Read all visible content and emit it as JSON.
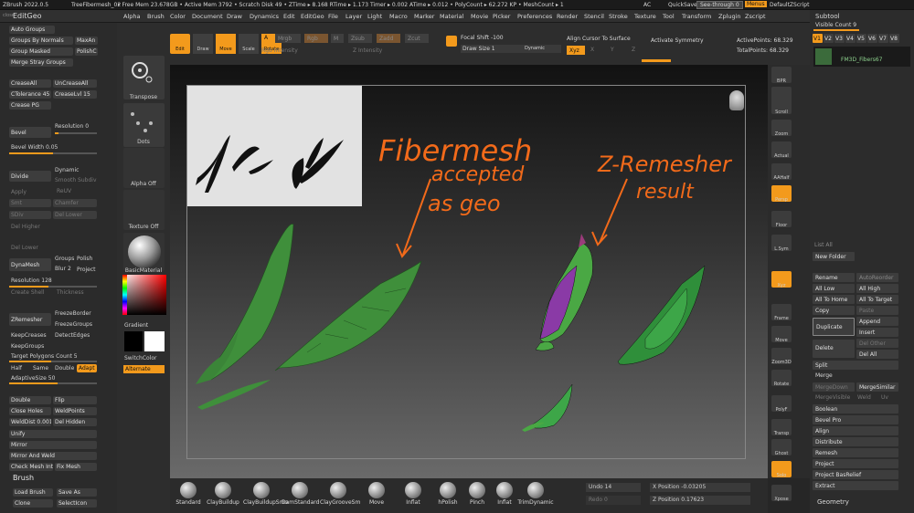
{
  "topbar": {
    "app": "ZBrush 2022.0.5",
    "file": "TreeFibermesh_02",
    "stats": "• Free Mem 23.678GB • Active Mem 3792 • Scratch Disk 49 • ZTime ▸ 8.168 RTime ▸ 1.173 Timer ▸ 0.002 ATime ▸ 0.012 • PolyCount ▸ 62.272 KP • MeshCount ▸ 1",
    "ac": "AC",
    "quicksave": "QuickSave",
    "seethrough": "See-through  0",
    "menus": "Menus",
    "script": "DefaultZScript"
  },
  "menus": [
    "Alpha",
    "Brush",
    "Color",
    "Document",
    "Draw",
    "Dynamics",
    "Edit",
    "EditGeo",
    "File",
    "Layer",
    "Light",
    "Macro",
    "Marker",
    "Material",
    "Movie",
    "Picker",
    "Preferences",
    "Render",
    "Stencil",
    "Stroke",
    "Texture",
    "Tool",
    "Transform",
    "Zplugin",
    "Zscript"
  ],
  "left": {
    "panel": "EditGeo",
    "close": "close",
    "auto_groups": "Auto Groups",
    "groups_by_normals": "Groups By Normals",
    "max_an": "MaxAn",
    "group_masked": "Group Masked",
    "polish": "PolishC",
    "merge_stray": "Merge Stray Groups",
    "crease_all": "CreaseAll",
    "uncrease_all": "UnCreaseAll",
    "ctolerance": "CTolerance 45",
    "crease_lvl": "CreaseLvl 15",
    "crease_pg": "Crease PG",
    "bevel": "Bevel",
    "resolution": "Resolution 0",
    "bevel_width": "Bevel Width 0.05",
    "divide": "Divide",
    "dynamic": "Dynamic",
    "smooth_subdiv": "Smooth Subdiv",
    "suv": "Suv",
    "apply": "Apply",
    "reuv": "ReUV",
    "smt": "Smt",
    "chamfer": "Chamfer",
    "sdiv": "SDiv",
    "del_lower": "Del Lower",
    "del_higher": "Del Higher",
    "del_lower2": "Del Lower",
    "dynamesh": "DynaMesh",
    "groups": "Groups",
    "polish2": "Polish",
    "blur": "Blur 2",
    "project": "Project",
    "resolution2": "Resolution 128",
    "create_shell": "Create Shell",
    "thickness": "Thickness",
    "zremesher": "ZRemesher",
    "freeze_border": "FreezeBorder",
    "freeze_groups": "FreezeGroups",
    "keep_creases": "KeepCreases",
    "detect_edges": "DetectEdges",
    "keep_groups": "KeepGroups",
    "target_polys": "Target Polygons Count 5",
    "half": "Half",
    "same": "Same",
    "double": "Double",
    "adapt": "Adapt",
    "adaptive_size": "AdaptiveSize 50",
    "double2": "Double",
    "flip": "Flip",
    "close_holes": "Close Holes",
    "weld_points": "WeldPoints",
    "weld_dist": "WeldDist 0.0010",
    "del_hidden": "Del Hidden",
    "unify": "Unify",
    "mirror": "Mirror",
    "mirror_weld": "Mirror And Weld",
    "check_mesh": "Check Mesh Int",
    "fix_mesh": "Fix Mesh",
    "brush_panel": "Brush",
    "load_brush": "Load Brush",
    "save_as": "Save As",
    "clone": "Clone",
    "select_icon": "SelectIcon"
  },
  "tools": {
    "transpose": "Transpose",
    "dots": "Dots",
    "alpha": "Alpha Off",
    "texture": "Texture Off",
    "material": "BasicMaterial",
    "gradient": "Gradient",
    "switch_color": "SwitchColor",
    "alternate": "Alternate"
  },
  "shelf": {
    "edit": "Edit",
    "draw": "Draw",
    "move": "Move",
    "scale": "Scale",
    "rotate": "Rotate",
    "a": "A",
    "mrgb": "Mrgb",
    "rgb": "Rgb",
    "m": "M",
    "zsub": "Zsub",
    "zadd": "Zadd",
    "zcut": "Zcut",
    "rgb_intensity": "Rgb Intensity",
    "z_intensity": "Z Intensity",
    "focal_shift": "Focal Shift -100",
    "draw_size": "Draw Size 1",
    "dynamic": "Dynamic",
    "align_cursor": "Align Cursor To Surface",
    "xyz": "Xyz",
    "x": "X",
    "y": "Y",
    "z": "Z",
    "activate_symmetry": "Activate Symmetry",
    "active_points": "ActivePoints: 68.329",
    "total_points": "TotalPoints: 68.329"
  },
  "annotations": {
    "fiber_title": "Fibermesh",
    "fiber_sub1": "accepted",
    "fiber_sub2": "as geo",
    "zr_title": "Z-Remesher",
    "zr_sub": "result"
  },
  "rtools": [
    "BPR",
    "SPix 3",
    "Scroll",
    "Zoom",
    "Actual",
    "AAHalf",
    "Persp",
    "Floor",
    "L.Sym",
    "Xyz",
    "Frame",
    "Move",
    "Zoom3D",
    "Rotate",
    "PolyF",
    "Transp",
    "Ghost",
    "Solo",
    "Xpose"
  ],
  "subtool": {
    "title": "Subtool",
    "visible": "Visible Count 9",
    "versions": [
      "V1",
      "V2",
      "V3",
      "V4",
      "V5",
      "V6",
      "V7",
      "V8"
    ],
    "item": "FM3D_Fibers67",
    "list_all": "List All",
    "new_folder": "New Folder",
    "rename": "Rename",
    "auto_reorder": "AutoReorder",
    "all_low": "All Low",
    "all_high": "All High",
    "all_to_home": "All To Home",
    "all_to_target": "All To Target",
    "copy": "Copy",
    "paste": "Paste",
    "duplicate": "Duplicate",
    "append": "Append",
    "insert": "Insert",
    "delete": "Delete",
    "del_other": "Del Other",
    "del_all": "Del All",
    "split": "Split",
    "merge": "Merge",
    "merge_down": "MergeDown",
    "merge_similar": "MergeSimilar",
    "merge_visible": "MergeVisible",
    "weld": "Weld",
    "uv": "Uv",
    "boolean": "Boolean",
    "bevel_pro": "Bevel Pro",
    "align": "Align",
    "distribute": "Distribute",
    "remesh": "Remesh",
    "project": "Project",
    "project_basrelief": "Project BasRelief",
    "extract": "Extract",
    "geometry": "Geometry"
  },
  "bottom": {
    "brushes": [
      "Standard",
      "ClayBuildup",
      "ClayBuildupSmo",
      "DamStandard",
      "ClayGrooveSm",
      "Move",
      "Inflat",
      "hPolish",
      "Pinch",
      "Inflat",
      "TrimDynamic"
    ],
    "undo": "Undo 14",
    "redo": "Redo 0",
    "x_pos": "X Position -0.03205",
    "z_pos": "Z Position 0.17623"
  }
}
